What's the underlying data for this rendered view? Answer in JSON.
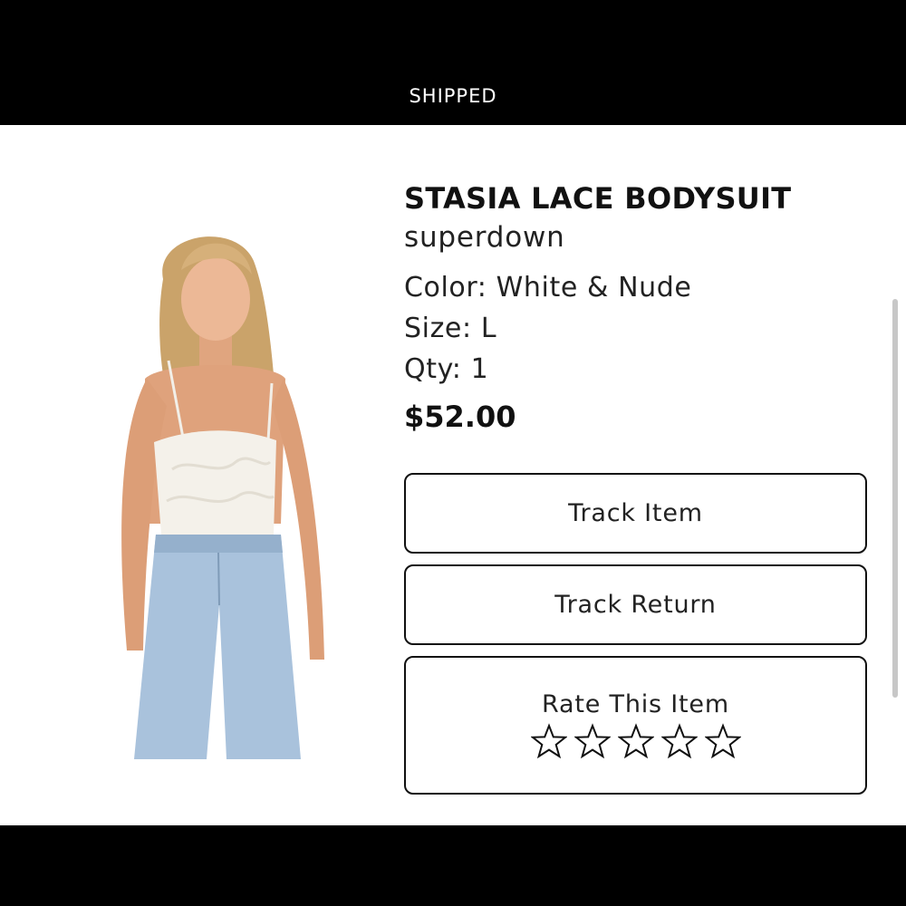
{
  "header": {
    "status": "SHIPPED"
  },
  "product": {
    "title": "STASIA LACE BODYSUIT",
    "brand": "superdown",
    "color": "Color: White & Nude",
    "size": "Size: L",
    "qty": "Qty: 1",
    "price": "$52.00",
    "image_icon": "model-photo"
  },
  "actions": {
    "track_item": "Track Item",
    "track_return": "Track Return"
  },
  "rating": {
    "label": "Rate This Item",
    "max_stars": 5,
    "selected": 0,
    "star_icon": "star-outline-icon"
  }
}
